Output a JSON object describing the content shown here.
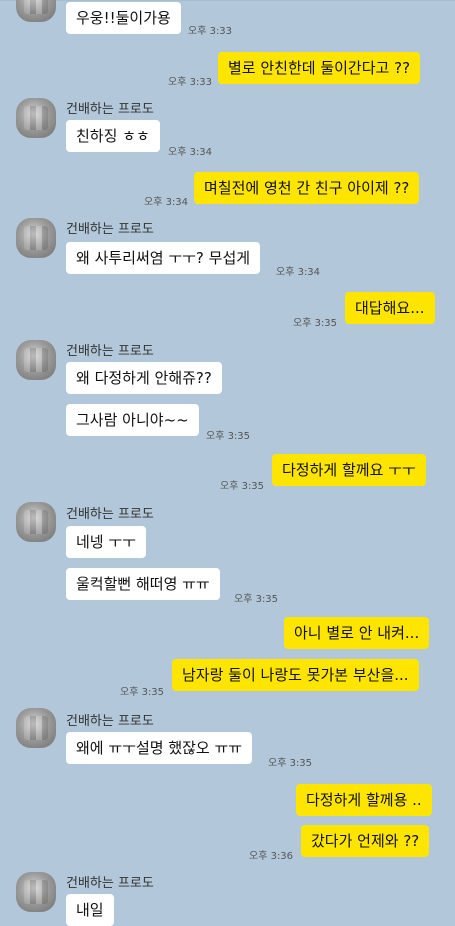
{
  "sender_name": "건배하는 프로도",
  "messages": [
    {
      "text": "우웅!!둘이가용",
      "time": "오후 3:33"
    },
    {
      "text": "별로 안친한데 둘이간다고 ??",
      "time": "오후 3:33"
    },
    {
      "text": "친하징 ㅎㅎ",
      "time": "오후 3:34"
    },
    {
      "text": "며칠전에 영천 간 친구 아이제 ??",
      "time": "오후 3:34"
    },
    {
      "text": "왜 사투리써염 ㅜㅜ? 무섭게",
      "time": "오후 3:34"
    },
    {
      "text": "대답해요...",
      "time": "오후 3:35"
    },
    {
      "text": "왜 다정하게 안해쥬??",
      "time": ""
    },
    {
      "text": "그사람 아니야~~",
      "time": "오후 3:35"
    },
    {
      "text": "다정하게 할께요 ㅜㅜ",
      "time": "오후 3:35"
    },
    {
      "text": "네넹 ㅜㅜ",
      "time": ""
    },
    {
      "text": "울컥할뻔 해떠영 ㅠㅠ",
      "time": "오후 3:35"
    },
    {
      "text": "아니 별로 안 내켜...",
      "time": ""
    },
    {
      "text": "남자랑 둘이 나랑도 못가본 부산을...",
      "time": "오후 3:35"
    },
    {
      "text": "왜에 ㅠㅜ설명 했잖오 ㅠㅠ",
      "time": "오후 3:35"
    },
    {
      "text": "다정하게 할께용 ..",
      "time": ""
    },
    {
      "text": "갔다가 언제와 ??",
      "time": "오후 3:36"
    },
    {
      "text": "내일",
      "time": ""
    }
  ],
  "icons": {
    "avatar": "blurred-profile-photo"
  },
  "colors": {
    "background": "#b2c7d9",
    "outgoing_bubble": "#fee500",
    "incoming_bubble": "#ffffff"
  }
}
